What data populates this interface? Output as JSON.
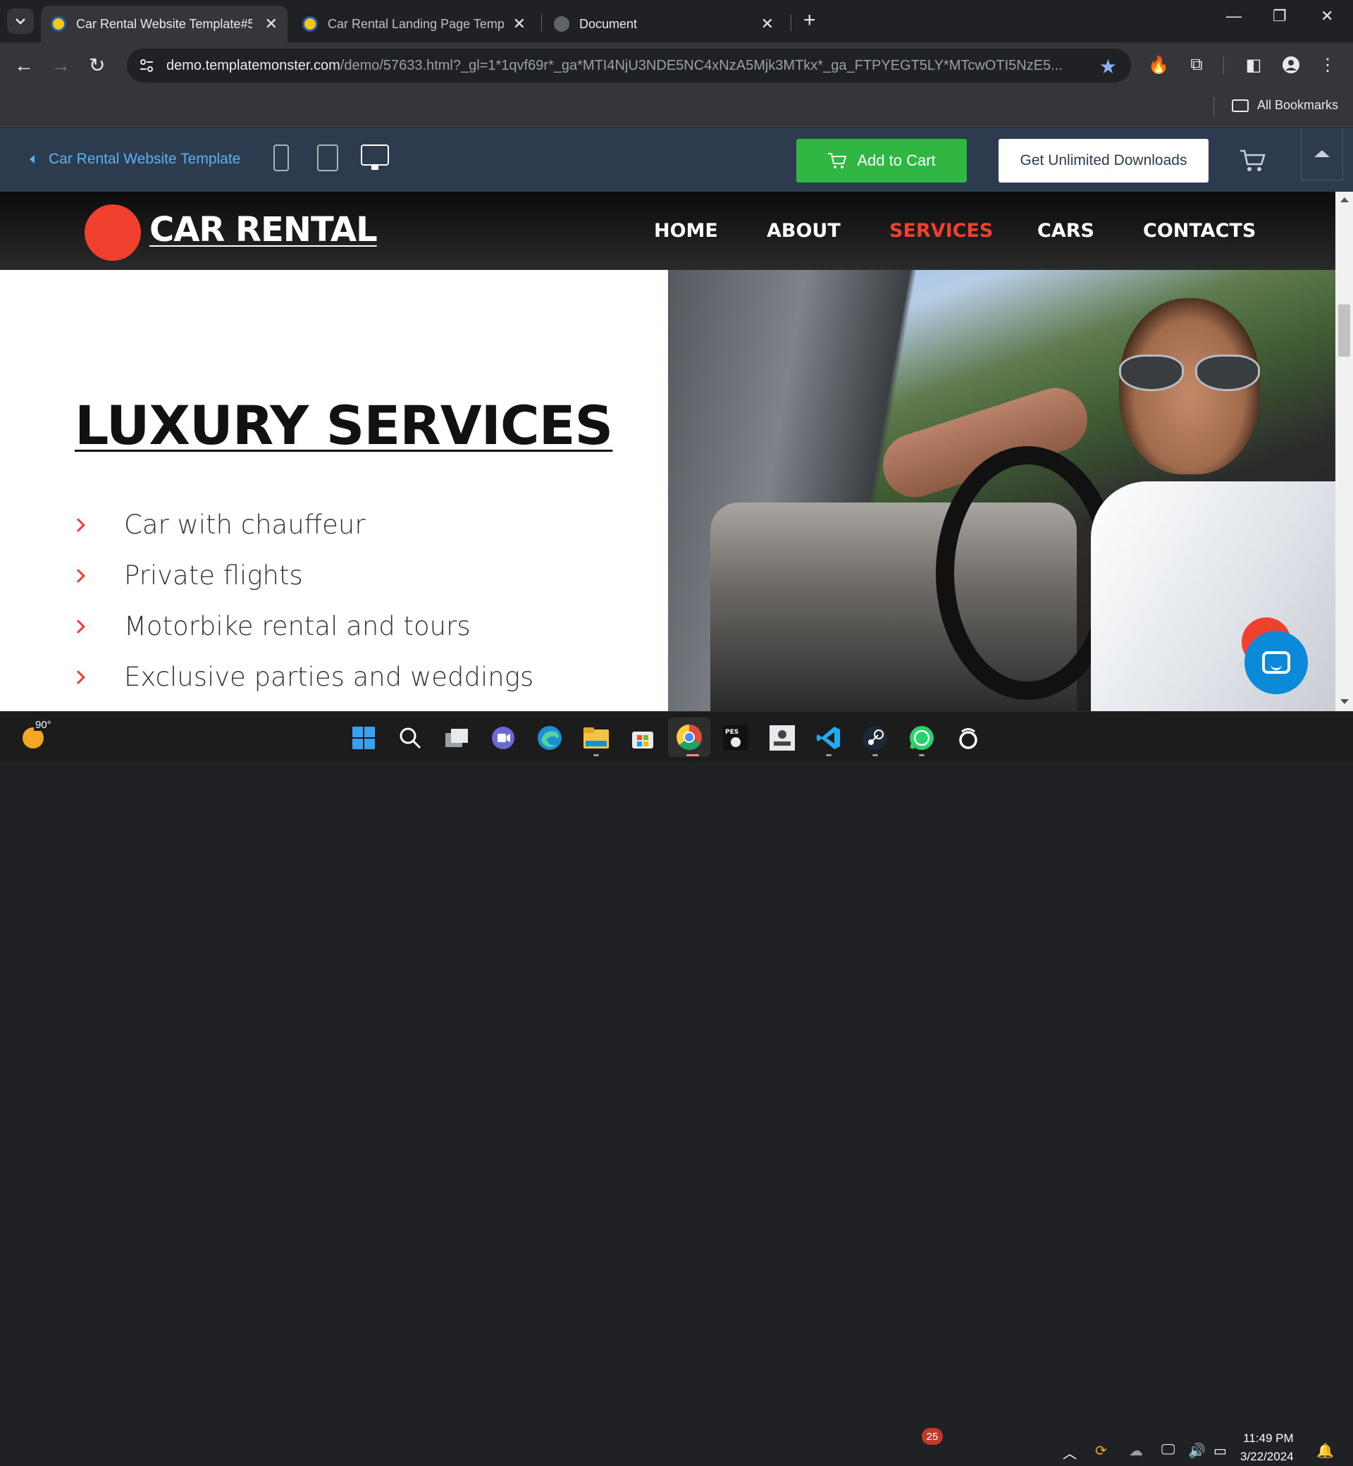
{
  "browser": {
    "tabs": [
      {
        "title": "Car Rental Website Template#5",
        "active": true
      },
      {
        "title": "Car Rental Landing Page Templa",
        "active": false
      },
      {
        "title": "Document",
        "active": false
      }
    ],
    "url_host": "demo.templatemonster.com",
    "url_rest": "/demo/57633.html?_gl=1*1qvf69r*_ga*MTI4NjU3NDE5NC4xNzA5Mjk3MTkx*_ga_FTPYEGT5LY*MTcwOTI5NzE5...",
    "bookmarks_label": "All Bookmarks"
  },
  "tm_bar": {
    "back_label": "Car Rental Website Template",
    "add_to_cart": "Add to Cart",
    "unlimited_downloads": "Get Unlimited Downloads"
  },
  "site": {
    "logo": "CAR RENTAL",
    "nav": [
      "HOME",
      "ABOUT",
      "SERVICES",
      "CARS",
      "CONTACTS"
    ],
    "active_nav": "SERVICES",
    "heading": "LUXURY SERVICES",
    "services": [
      "Car with chauffeur",
      "Private flights",
      "Motorbike rental and tours",
      "Exclusive parties and weddings"
    ]
  },
  "taskbar": {
    "weather_temp": "90°",
    "whatsapp_badge": "25",
    "time": "11:49 PM",
    "date": "3/22/2024"
  },
  "colors": {
    "accent_red": "#f0402e",
    "cart_green": "#2fb643",
    "tm_navy": "#2d3b4f"
  }
}
